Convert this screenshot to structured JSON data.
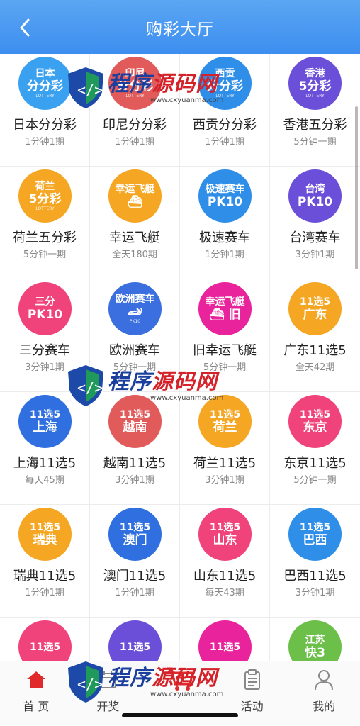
{
  "header": {
    "title": "购彩大厅"
  },
  "games": [
    {
      "name": "日本分分彩",
      "period": "1分钟1期",
      "color": "#3aa0f0",
      "logo": [
        "日本",
        "分分彩",
        "LOTTERY"
      ]
    },
    {
      "name": "印尼分分彩",
      "period": "1分钟1期",
      "color": "#e25b5b",
      "logo": [
        "印尼",
        "分分彩",
        "LOTTERY"
      ]
    },
    {
      "name": "西贡分分彩",
      "period": "1分钟1期",
      "color": "#2f8fe8",
      "logo": [
        "西贡",
        "分分彩",
        "LOTTERY"
      ]
    },
    {
      "name": "香港五分彩",
      "period": "5分钟一期",
      "color": "#6b4fd8",
      "logo": [
        "香港",
        "5分彩",
        "LOTTERY"
      ]
    },
    {
      "name": "荷兰五分彩",
      "period": "5分钟一期",
      "color": "#f5a623",
      "logo": [
        "荷兰",
        "5分彩",
        "LOTTERY"
      ]
    },
    {
      "name": "幸运飞艇",
      "period": "全天180期",
      "color": "#f5a623",
      "logo": [
        "幸运飞艇",
        "⛴",
        ""
      ]
    },
    {
      "name": "极速赛车",
      "period": "1分钟1期",
      "color": "#2f8fe8",
      "logo": [
        "极速赛车",
        "PK10",
        ""
      ]
    },
    {
      "name": "台湾赛车",
      "period": "3分钟1期",
      "color": "#6b4fd8",
      "logo": [
        "台湾",
        "PK10",
        ""
      ]
    },
    {
      "name": "三分赛车",
      "period": "3分钟1期",
      "color": "#f0437c",
      "logo": [
        "三分",
        "PK10",
        ""
      ]
    },
    {
      "name": "欧洲赛车",
      "period": "5分钟一期",
      "color": "#3b6fe0",
      "logo": [
        "欧洲赛车",
        "🏎",
        "PK10"
      ]
    },
    {
      "name": "旧幸运飞艇",
      "period": "5分钟一期",
      "color": "#e8239b",
      "logo": [
        "幸运飞艇",
        "⛴ 旧",
        ""
      ]
    },
    {
      "name": "广东11选5",
      "period": "全天42期",
      "color": "#f5a623",
      "logo": [
        "11选5",
        "广东",
        ""
      ]
    },
    {
      "name": "上海11选5",
      "period": "每天45期",
      "color": "#2f6fe0",
      "logo": [
        "11选5",
        "上海",
        ""
      ]
    },
    {
      "name": "越南11选5",
      "period": "3分钟1期",
      "color": "#e25b5b",
      "logo": [
        "11选5",
        "越南",
        ""
      ]
    },
    {
      "name": "荷兰11选5",
      "period": "3分钟1期",
      "color": "#f5a623",
      "logo": [
        "11选5",
        "荷兰",
        ""
      ]
    },
    {
      "name": "东京11选5",
      "period": "5分钟一期",
      "color": "#f0437c",
      "logo": [
        "11选5",
        "东京",
        ""
      ]
    },
    {
      "name": "瑞典11选5",
      "period": "1分钟1期",
      "color": "#f5a623",
      "logo": [
        "11选5",
        "瑞典",
        ""
      ]
    },
    {
      "name": "澳门11选5",
      "period": "1分钟1期",
      "color": "#2f6fe0",
      "logo": [
        "11选5",
        "澳门",
        ""
      ]
    },
    {
      "name": "山东11选5",
      "period": "每天43期",
      "color": "#f0437c",
      "logo": [
        "11选5",
        "山东",
        ""
      ]
    },
    {
      "name": "巴西11选5",
      "period": "3分钟1期",
      "color": "#2f8fe8",
      "logo": [
        "11选5",
        "巴西",
        ""
      ]
    },
    {
      "name": "",
      "period": "",
      "color": "#f0437c",
      "logo": [
        "11选5",
        "",
        ""
      ]
    },
    {
      "name": "",
      "period": "",
      "color": "#6b4fd8",
      "logo": [
        "11选5",
        "",
        ""
      ]
    },
    {
      "name": "",
      "period": "",
      "color": "#e8239b",
      "logo": [
        "11选5",
        "",
        ""
      ]
    },
    {
      "name": "",
      "period": "",
      "color": "#6cc04a",
      "logo": [
        "江苏",
        "快3",
        ""
      ]
    }
  ],
  "tabbar": [
    {
      "label": "首 页",
      "icon": "home-icon",
      "color": "#e02a2a"
    },
    {
      "label": "开奖",
      "icon": "calendar-icon",
      "color": "#888888"
    },
    {
      "label": "",
      "icon": "cart-icon",
      "color": "#e02a2a"
    },
    {
      "label": "活动",
      "icon": "clipboard-icon",
      "color": "#888888"
    },
    {
      "label": "我的",
      "icon": "user-icon",
      "color": "#888888"
    }
  ],
  "watermark": {
    "text": "程序源码网",
    "highlight": "源码网",
    "url": "www.cxyuanma.com"
  }
}
